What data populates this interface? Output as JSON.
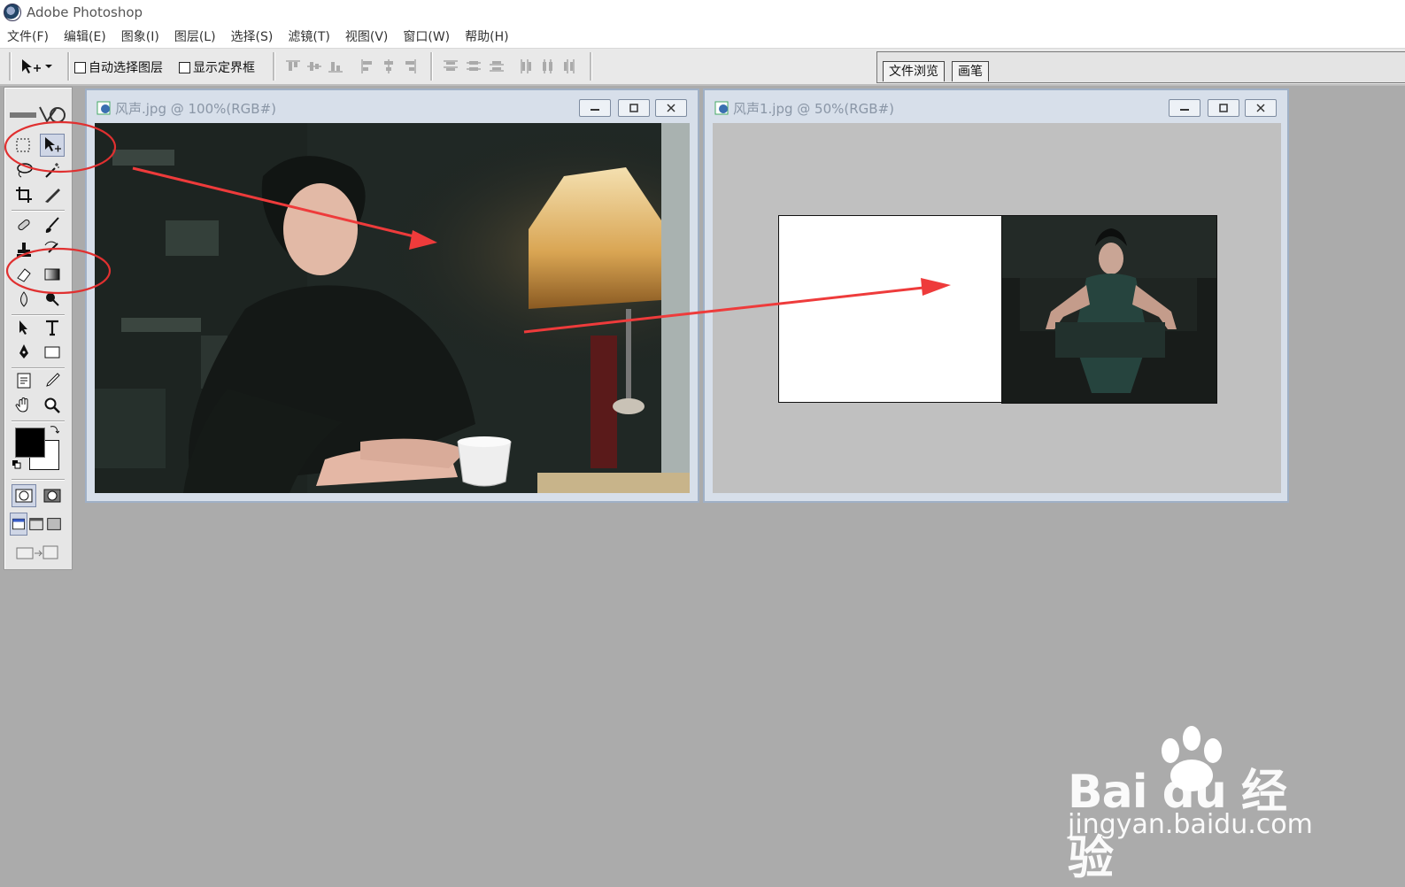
{
  "app": {
    "title": "Adobe Photoshop"
  },
  "menubar": [
    "文件(F)",
    "编辑(E)",
    "图象(I)",
    "图层(L)",
    "选择(S)",
    "滤镜(T)",
    "视图(V)",
    "窗口(W)",
    "帮助(H)"
  ],
  "options": {
    "auto_select_layer": "自动选择图层",
    "show_bounding_box": "显示定界框"
  },
  "palette_well": {
    "tabs": [
      "文件浏览",
      "画笔"
    ]
  },
  "documents": [
    {
      "title": "风声.jpg @ 100%(RGB#)"
    },
    {
      "title": "风声1.jpg @ 50%(RGB#)"
    }
  ],
  "annotations": {
    "arrow_color": "#ee3b3b",
    "circle_color": "#e03030"
  },
  "watermark": {
    "brand": "Bai du 经验",
    "url": "jingyan.baidu.com"
  },
  "icons": [
    "photoshop-logo-icon",
    "move-tool-icon",
    "marquee-tool-icon",
    "lasso-tool-icon",
    "magic-wand-icon",
    "crop-tool-icon",
    "slice-tool-icon",
    "healing-brush-icon",
    "brush-tool-icon",
    "clone-stamp-icon",
    "history-brush-icon",
    "eraser-tool-icon",
    "gradient-tool-icon",
    "blur-tool-icon",
    "dodge-tool-icon",
    "path-select-icon",
    "type-tool-icon",
    "pen-tool-icon",
    "shape-tool-icon",
    "notes-tool-icon",
    "eyedropper-icon",
    "hand-tool-icon",
    "zoom-tool-icon"
  ]
}
